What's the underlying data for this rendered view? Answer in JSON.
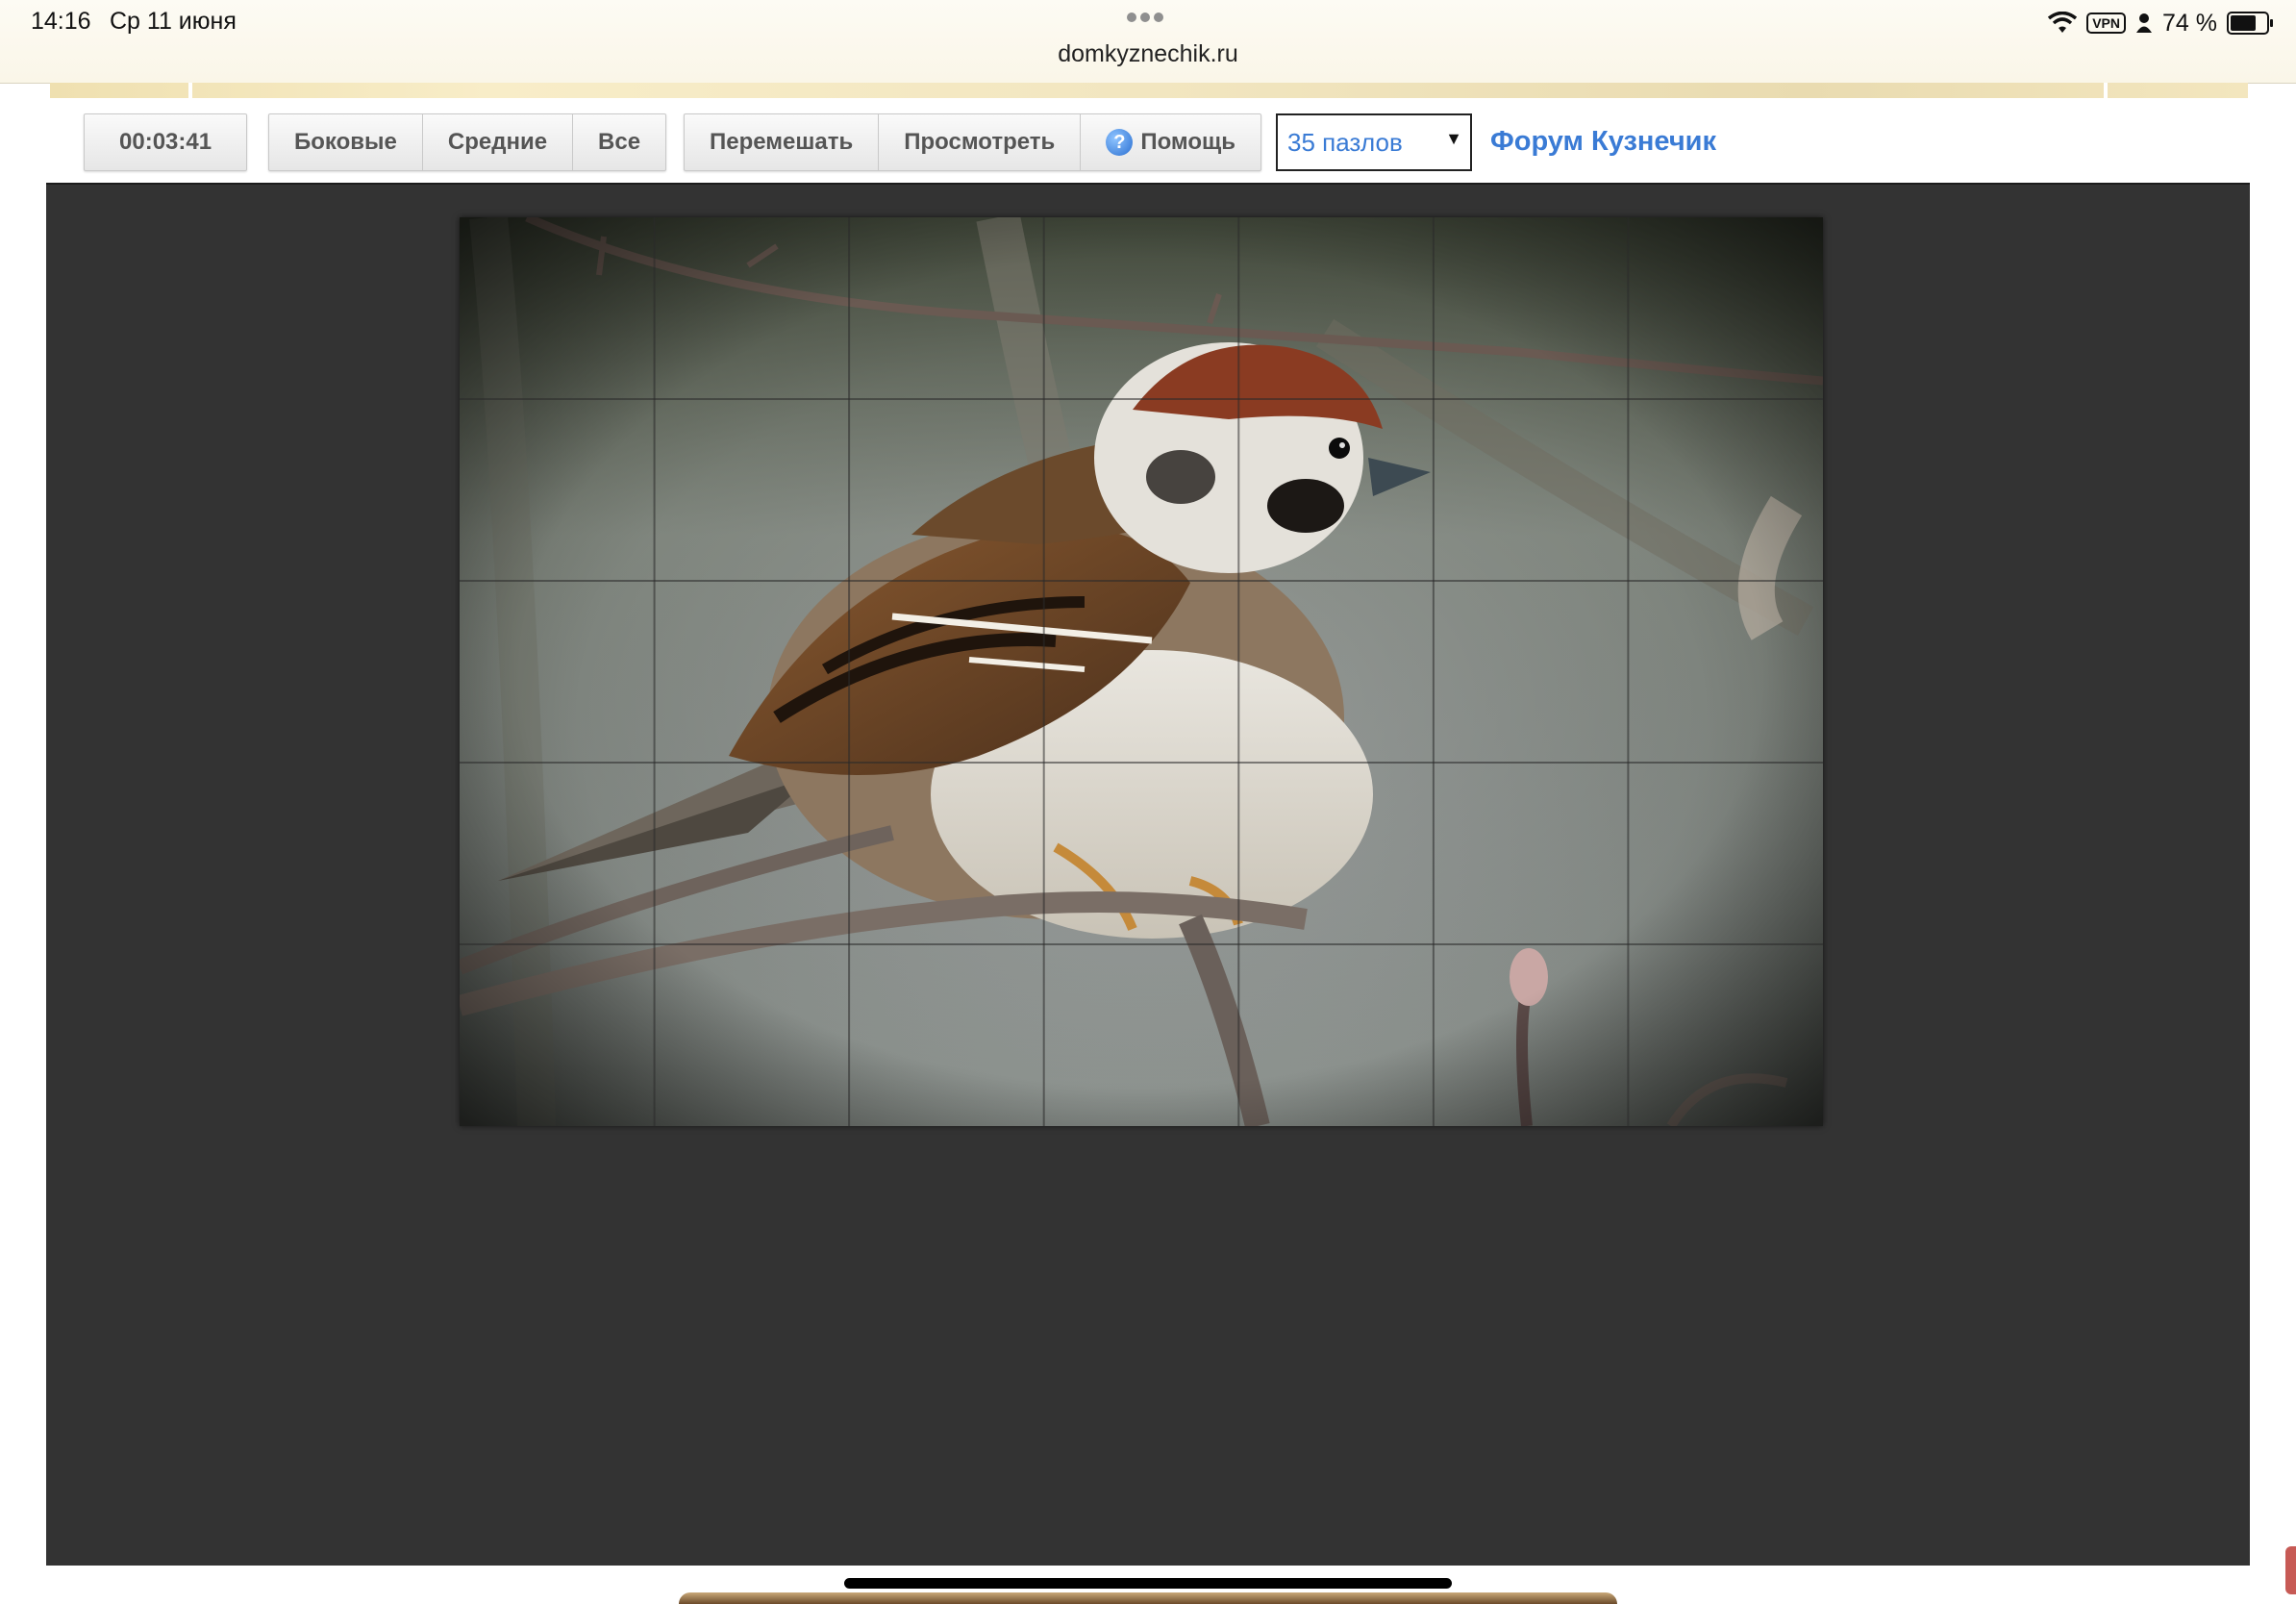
{
  "status_bar": {
    "time": "14:16",
    "date": "Ср 11 июня",
    "url": "domkyznechik.ru",
    "vpn": "VPN",
    "battery": "74 %",
    "icons": [
      "wifi-icon",
      "vpn-icon",
      "person-icon",
      "battery-icon"
    ]
  },
  "toolbar": {
    "timer": "00:03:41",
    "filter_buttons": [
      "Боковые",
      "Средние",
      "Все"
    ],
    "shuffle_label": "Перемешать",
    "preview_label": "Просмотреть",
    "help_label": "Помощь",
    "help_icon": "question-circle-icon",
    "select_value": "35 пазлов",
    "forum_link": "Форум Кузнечик"
  },
  "puzzle": {
    "rows": 5,
    "cols": 7,
    "image_subject": "sparrow-on-branch"
  },
  "colors": {
    "board": "#333333",
    "link": "#3a7bd5"
  }
}
